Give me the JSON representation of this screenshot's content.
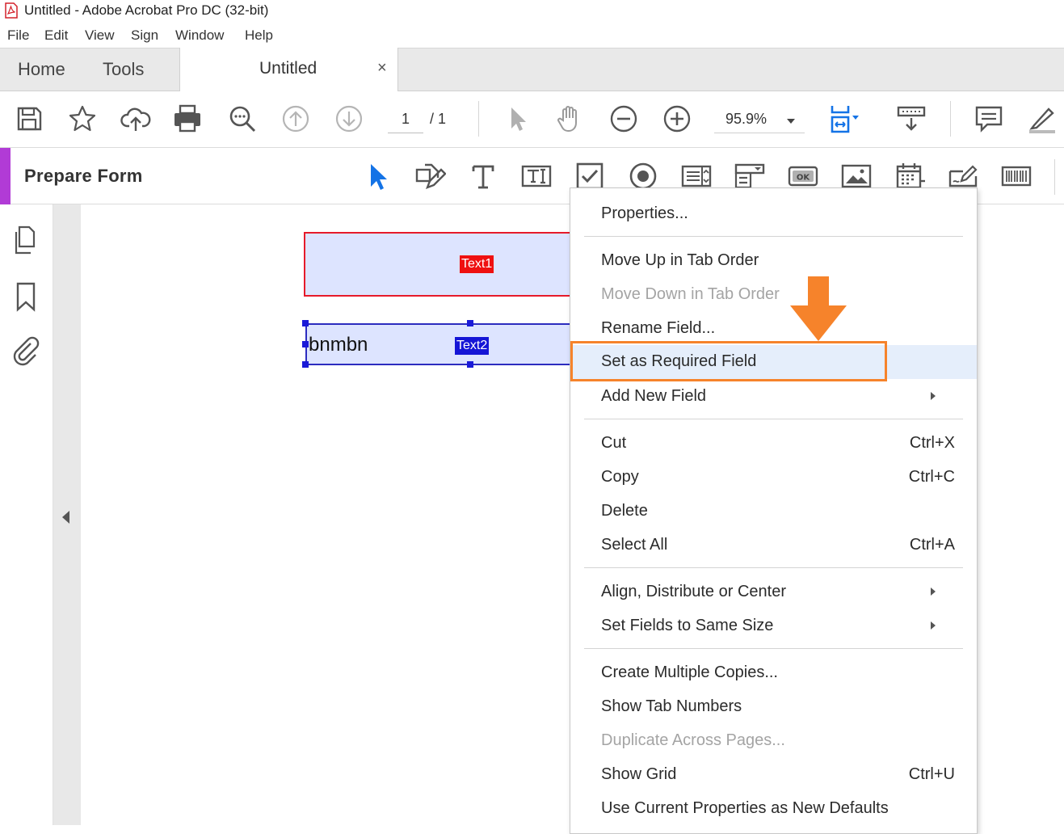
{
  "window": {
    "title": "Untitled - Adobe Acrobat Pro DC (32-bit)"
  },
  "menubar": {
    "items": [
      "File",
      "Edit",
      "View",
      "Sign",
      "Window",
      "Help"
    ]
  },
  "tabs": {
    "home": "Home",
    "tools": "Tools",
    "document": "Untitled",
    "close": "×"
  },
  "toolbar": {
    "page_current": "1",
    "page_total": "/  1",
    "zoom": "95.9%"
  },
  "form_panel": {
    "title": "Prepare Form"
  },
  "document": {
    "field1_label": "Text1",
    "field2_value": "bnmbn",
    "field2_label": "Text2"
  },
  "context_menu": {
    "items": [
      {
        "label": "Properties...",
        "shortcut": ""
      },
      {
        "label": "Move Up in Tab Order",
        "shortcut": ""
      },
      {
        "label": "Move Down in Tab Order",
        "shortcut": ""
      },
      {
        "label": "Rename Field...",
        "shortcut": ""
      },
      {
        "label": "Set as Required Field",
        "shortcut": ""
      },
      {
        "label": "Add New Field",
        "shortcut": ""
      },
      {
        "label": "Cut",
        "shortcut": "Ctrl+X"
      },
      {
        "label": "Copy",
        "shortcut": "Ctrl+C"
      },
      {
        "label": "Delete",
        "shortcut": ""
      },
      {
        "label": "Select All",
        "shortcut": "Ctrl+A"
      },
      {
        "label": "Align, Distribute or Center",
        "shortcut": ""
      },
      {
        "label": "Set Fields to Same Size",
        "shortcut": ""
      },
      {
        "label": "Create Multiple Copies...",
        "shortcut": ""
      },
      {
        "label": "Show Tab Numbers",
        "shortcut": ""
      },
      {
        "label": "Duplicate Across Pages...",
        "shortcut": ""
      },
      {
        "label": "Show Grid",
        "shortcut": "Ctrl+U"
      },
      {
        "label": "Use Current Properties as New Defaults",
        "shortcut": ""
      }
    ]
  },
  "colors": {
    "accent_purple": "#b13bd6",
    "highlight_orange": "#f6832b",
    "field_required_red": "#e61a2a",
    "field_selected_blue": "#1a1ad8",
    "icon_blue": "#1473e6"
  },
  "icons": {
    "toolbar": [
      "save-icon",
      "bookmark-star-icon",
      "upload-cloud-icon",
      "print-icon",
      "zoom-search-icon",
      "page-up-icon",
      "page-down-icon",
      "select-arrow-icon",
      "hand-icon",
      "zoom-out-icon",
      "zoom-in-icon",
      "fit-page-icon",
      "scroll-mode-icon",
      "comment-icon",
      "highlight-pen-icon"
    ],
    "form_tools": [
      "select-object-icon",
      "edit-form-icon",
      "text-icon",
      "text-field-icon",
      "checkbox-icon",
      "radio-button-icon",
      "list-box-icon",
      "dropdown-icon",
      "button-ok-icon",
      "image-field-icon",
      "date-field-icon",
      "signature-field-icon",
      "barcode-icon"
    ],
    "left_nav": [
      "page-thumbnails-icon",
      "bookmarks-icon",
      "attachments-icon"
    ]
  }
}
